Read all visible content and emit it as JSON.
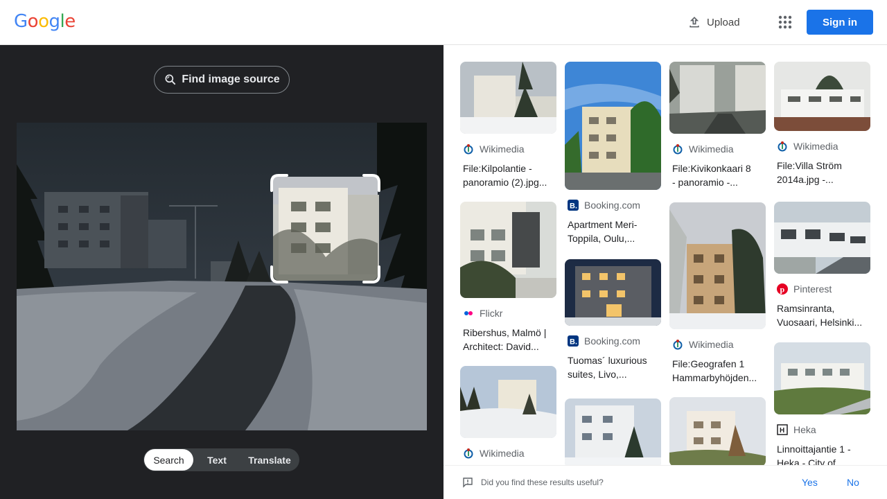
{
  "header": {
    "logo": "Google",
    "upload_label": "Upload",
    "signin_label": "Sign in",
    "accent": "#1a73e8"
  },
  "lens": {
    "find_source_label": "Find image source",
    "modes": [
      "Search",
      "Text",
      "Translate"
    ],
    "active_mode": "Search"
  },
  "results": [
    {
      "source": "Wikimedia",
      "icon": "wikimedia-icon",
      "title": "File:Kilpolantie -\npanoramio (2).jpg..."
    },
    {
      "source": "Booking.com",
      "icon": "booking-icon",
      "title": "Apartment Meri-\nToppila, Oulu,..."
    },
    {
      "source": "Wikimedia",
      "icon": "wikimedia-icon",
      "title": "File:Kivikonkaari 8\n- panoramio -..."
    },
    {
      "source": "Wikimedia",
      "icon": "wikimedia-icon",
      "title": "File:Villa Ström\n2014a.jpg -..."
    },
    {
      "source": "Flickr",
      "icon": "flickr-icon",
      "title": "Ribershus, Malmö |\nArchitect: David..."
    },
    {
      "source": "Booking.com",
      "icon": "booking-icon",
      "title": "Tuomas´ luxurious\nsuites, Livo,..."
    },
    {
      "source": "Wikimedia",
      "icon": "wikimedia-icon",
      "title": "File:Geografen 1\nHammarbyhöjden..."
    },
    {
      "source": "Pinterest",
      "icon": "pinterest-icon",
      "title": "Ramsinranta,\nVuosaari, Helsinki..."
    },
    {
      "source": "Wikimedia",
      "icon": "wikimedia-icon",
      "title": ""
    },
    {
      "source": "Heka",
      "icon": "heka-icon",
      "title": "Linnoittajantie 1 -\nHeka - City of..."
    }
  ],
  "feedback": {
    "question": "Did you find these results useful?",
    "yes": "Yes",
    "no": "No"
  }
}
